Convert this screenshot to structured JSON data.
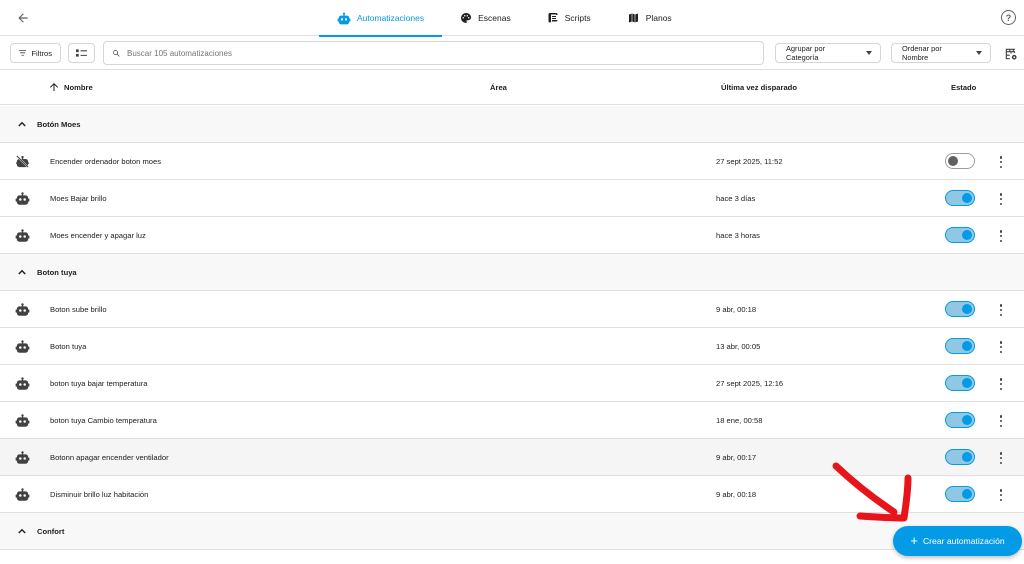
{
  "tabs": [
    {
      "label": "Automatizaciones",
      "icon": "robot-icon",
      "active": true
    },
    {
      "label": "Escenas",
      "icon": "palette-icon",
      "active": false
    },
    {
      "label": "Scripts",
      "icon": "script-icon",
      "active": false
    },
    {
      "label": "Planos",
      "icon": "blueprint-icon",
      "active": false
    }
  ],
  "toolbar": {
    "filters_label": "Filtros",
    "search_placeholder": "Buscar 105 automatizaciones",
    "group_by_label": "Agrupar por Categoría",
    "sort_by_label": "Ordenar por Nombre"
  },
  "table": {
    "columns": {
      "name": "Nombre",
      "area": "Área",
      "last_triggered": "Última vez disparado",
      "state": "Estado"
    },
    "groups": [
      {
        "label": "Botón Moes",
        "rows": [
          {
            "name": "Encender ordenador boton moes",
            "last_triggered": "27 sept 2025, 11:52",
            "enabled": false,
            "icon": "robot-off-icon"
          },
          {
            "name": "Moes Bajar brillo",
            "last_triggered": "hace 3 días",
            "enabled": true,
            "icon": "robot-icon"
          },
          {
            "name": "Moes encender y apagar luz",
            "last_triggered": "hace 3 horas",
            "enabled": true,
            "icon": "robot-icon"
          }
        ]
      },
      {
        "label": "Boton tuya",
        "rows": [
          {
            "name": "Boton sube brillo",
            "last_triggered": "9 abr, 00:18",
            "enabled": true,
            "icon": "robot-icon"
          },
          {
            "name": "Boton tuya",
            "last_triggered": "13 abr, 00:05",
            "enabled": true,
            "icon": "robot-icon"
          },
          {
            "name": "boton tuya bajar temperatura",
            "last_triggered": "27 sept 2025, 12:16",
            "enabled": true,
            "icon": "robot-icon"
          },
          {
            "name": "boton tuya Cambio temperatura",
            "last_triggered": "18 ene, 00:58",
            "enabled": true,
            "icon": "robot-icon"
          },
          {
            "name": "Botonn apagar encender ventilador",
            "last_triggered": "9 abr, 00:17",
            "enabled": true,
            "icon": "robot-icon",
            "hovered": true
          },
          {
            "name": "Disminuir brillo luz habitación",
            "last_triggered": "9 abr, 00:18",
            "enabled": true,
            "icon": "robot-icon"
          }
        ]
      },
      {
        "label": "Confort",
        "rows": []
      }
    ]
  },
  "fab": {
    "label": "Crear automatización"
  },
  "colors": {
    "accent": "#039be5",
    "annotation_arrow": "#e8141c"
  }
}
